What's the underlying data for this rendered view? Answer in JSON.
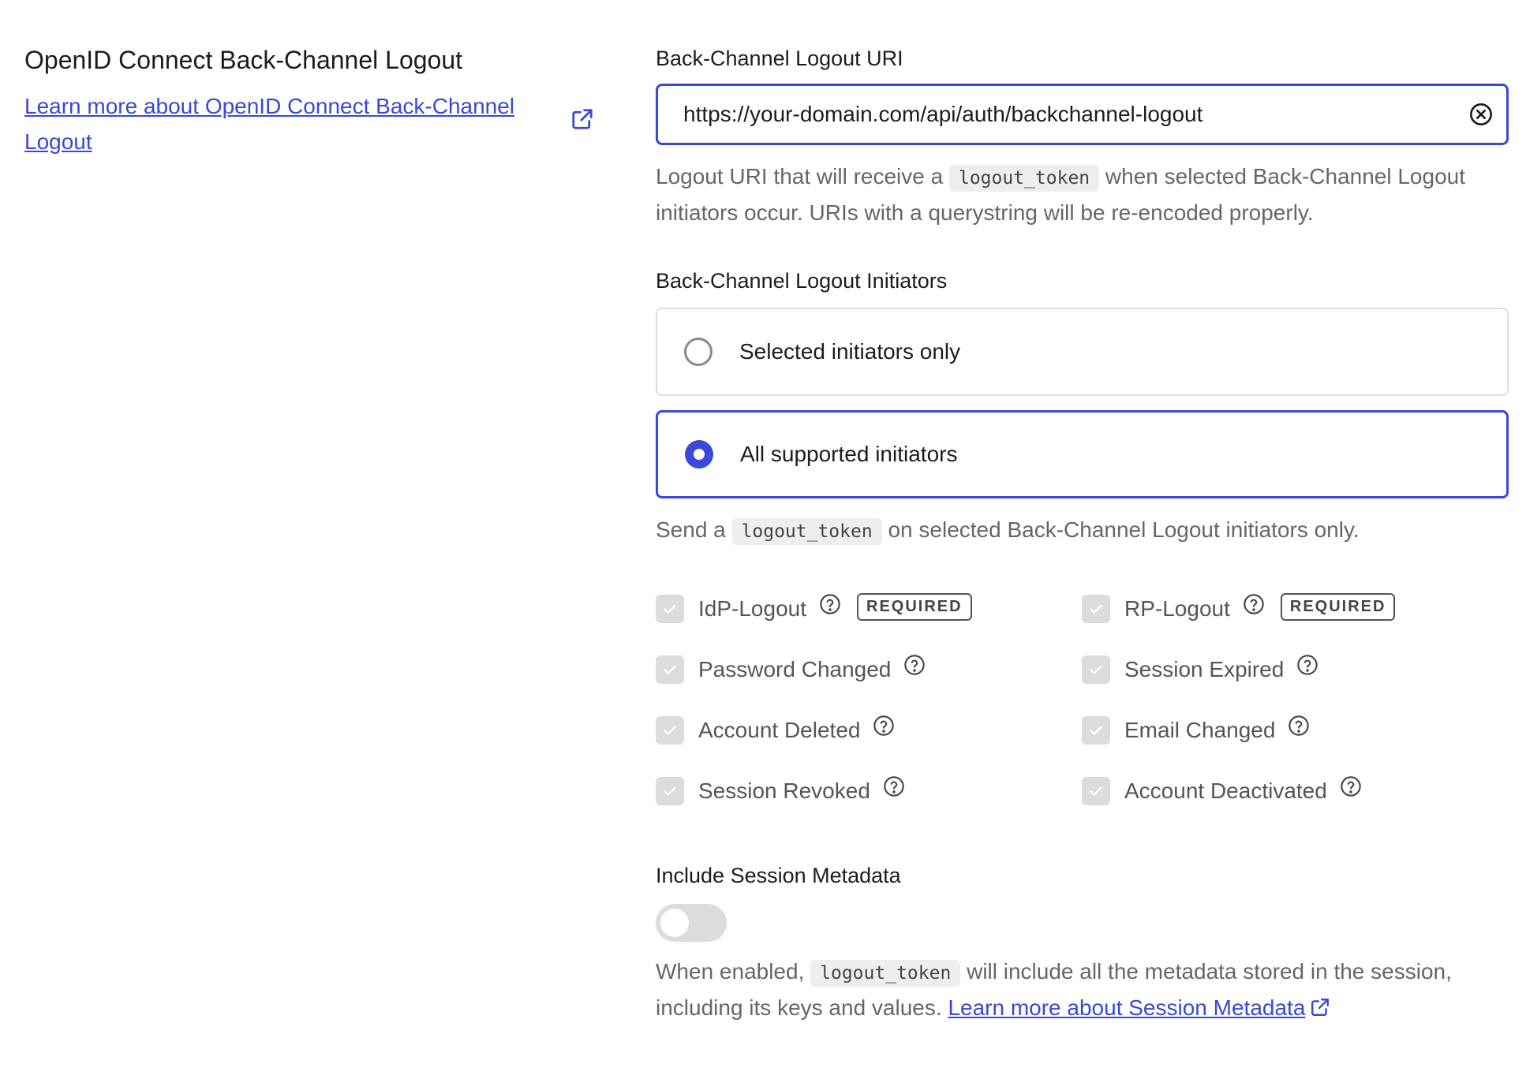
{
  "section": {
    "title": "OpenID Connect Back-Channel Logout",
    "learn_more_link": "Learn more about OpenID Connect Back-Channel Logout"
  },
  "uri_field": {
    "label": "Back-Channel Logout URI",
    "value": "https://your-domain.com/api/auth/backchannel-logout",
    "help_before": "Logout URI that will receive a",
    "help_code": "logout_token",
    "help_after": "when selected Back-Channel Logout initiators occur. URIs with a querystring will be re-encoded properly."
  },
  "initiators": {
    "label": "Back-Channel Logout Initiators",
    "options": [
      {
        "label": "Selected initiators only",
        "selected": false
      },
      {
        "label": "All supported initiators",
        "selected": true
      }
    ],
    "help_before": "Send a",
    "help_code": "logout_token",
    "help_after": "on selected Back-Channel Logout initiators only.",
    "required_badge": "REQUIRED",
    "checkboxes": [
      {
        "label": "IdP-Logout",
        "checked": true,
        "required": true
      },
      {
        "label": "RP-Logout",
        "checked": true,
        "required": true
      },
      {
        "label": "Password Changed",
        "checked": true,
        "required": false
      },
      {
        "label": "Session Expired",
        "checked": true,
        "required": false
      },
      {
        "label": "Account Deleted",
        "checked": true,
        "required": false
      },
      {
        "label": "Email Changed",
        "checked": true,
        "required": false
      },
      {
        "label": "Session Revoked",
        "checked": true,
        "required": false
      },
      {
        "label": "Account Deactivated",
        "checked": true,
        "required": false
      }
    ]
  },
  "session_metadata": {
    "label": "Include Session Metadata",
    "enabled": false,
    "help_before": "When enabled,",
    "help_code": "logout_token",
    "help_after": "will include all the metadata stored in the session, including its keys and values.",
    "link": "Learn more about Session Metadata"
  },
  "colors": {
    "accent": "#3b48d8",
    "link": "#3a48d6",
    "disabled_checkbox": "#dcdcdc"
  }
}
